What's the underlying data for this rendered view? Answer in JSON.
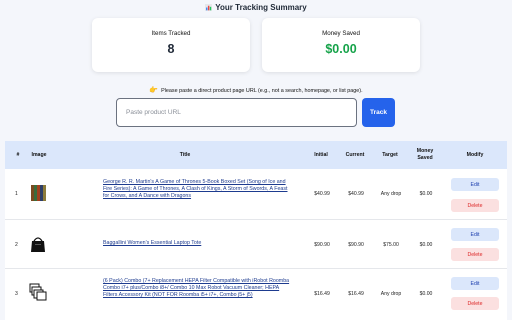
{
  "summary": {
    "icon": "bar-chart-icon",
    "title": "Your Tracking Summary",
    "items_tracked_label": "Items Tracked",
    "items_tracked_value": "8",
    "money_saved_label": "Money Saved",
    "money_saved_value": "$0.00",
    "money_color": "#16a34a"
  },
  "hint": {
    "icon": "pointing-hand-icon",
    "text": "Please paste a direct product page URL (e.g., not a search, homepage, or list page)."
  },
  "url_input": {
    "placeholder": "Paste product URL",
    "value": ""
  },
  "track_button": {
    "label": "Track",
    "color": "#2563eb"
  },
  "table": {
    "headers": {
      "num": "#",
      "image": "Image",
      "title": "Title",
      "initial": "Initial",
      "current": "Current",
      "target": "Target",
      "money_saved_1": "Money",
      "money_saved_2": "Saved",
      "modify": "Modify"
    },
    "rows": [
      {
        "num": "1",
        "image": "book-cover-thumbnail",
        "title": "George R. R. Martin's A Game of Thrones 5-Book Boxed Set (Song of Ice and Fire Series): A Game of Thrones, A Clash of Kings, A Storm of Swords, A Feast for Crows, and A Dance with Dragons",
        "initial": "$40.99",
        "current": "$40.99",
        "target": "Any drop",
        "money_saved": "$0.00",
        "edit": "Edit",
        "delete": "Delete"
      },
      {
        "num": "2",
        "image": "laptop-tote-thumbnail",
        "title": "Baggallini Women's Essential Laptop Tote",
        "initial": "$90.90",
        "current": "$90.90",
        "target": "$75.00",
        "money_saved": "$0.00",
        "edit": "Edit",
        "delete": "Delete"
      },
      {
        "num": "3",
        "image": "hepa-filter-thumbnail",
        "title": "(6 Pack) Combo (7+ Replacement HEPA Filter Compatible with iRobot Roomba Combo i7+ plus/Combo i8+/ Combo 10 Max Robot Vacuum Cleaner; HEPA Filters Accessory Kit (NOT FOR Roomba i5+ i7+, Combo j5+ j5)",
        "initial": "$16.49",
        "current": "$16.49",
        "target": "Any drop",
        "money_saved": "$0.00",
        "edit": "Edit",
        "delete": "Delete"
      }
    ]
  }
}
